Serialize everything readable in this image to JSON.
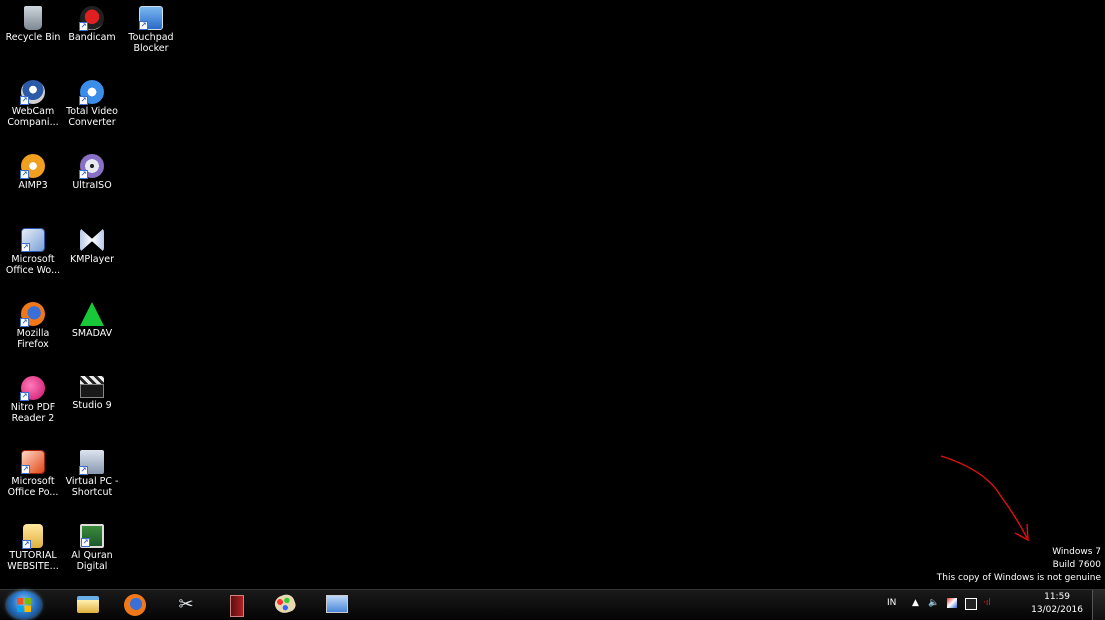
{
  "desktop_icons": [
    {
      "label": "Recycle Bin"
    },
    {
      "label": "Bandicam"
    },
    {
      "label": "Touchpad\nBlocker"
    },
    {
      "label": "WebCam\nCompani..."
    },
    {
      "label": "Total Video\nConverter"
    },
    {
      "label": "AIMP3"
    },
    {
      "label": "UltraISO"
    },
    {
      "label": "Microsoft\nOffice Wo..."
    },
    {
      "label": "KMPlayer"
    },
    {
      "label": "Mozilla\nFirefox"
    },
    {
      "label": "SMADAV"
    },
    {
      "label": "Nitro PDF\nReader 2"
    },
    {
      "label": "Studio 9"
    },
    {
      "label": "Microsoft\nOffice Po..."
    },
    {
      "label": "Virtual PC -\nShortcut"
    },
    {
      "label": "TUTORIAL\nWEBSITE..."
    },
    {
      "label": "Al Quran\nDigital"
    }
  ],
  "watermark": {
    "line1": "Windows 7",
    "line2": "Build 7600",
    "line3": "This copy of Windows is not genuine"
  },
  "taskbar": {
    "language": "IN",
    "time": "11:59",
    "date": "13/02/2016"
  },
  "colors": {
    "desktop_bg": "#000000",
    "annotation_arrow": "#e01010"
  }
}
